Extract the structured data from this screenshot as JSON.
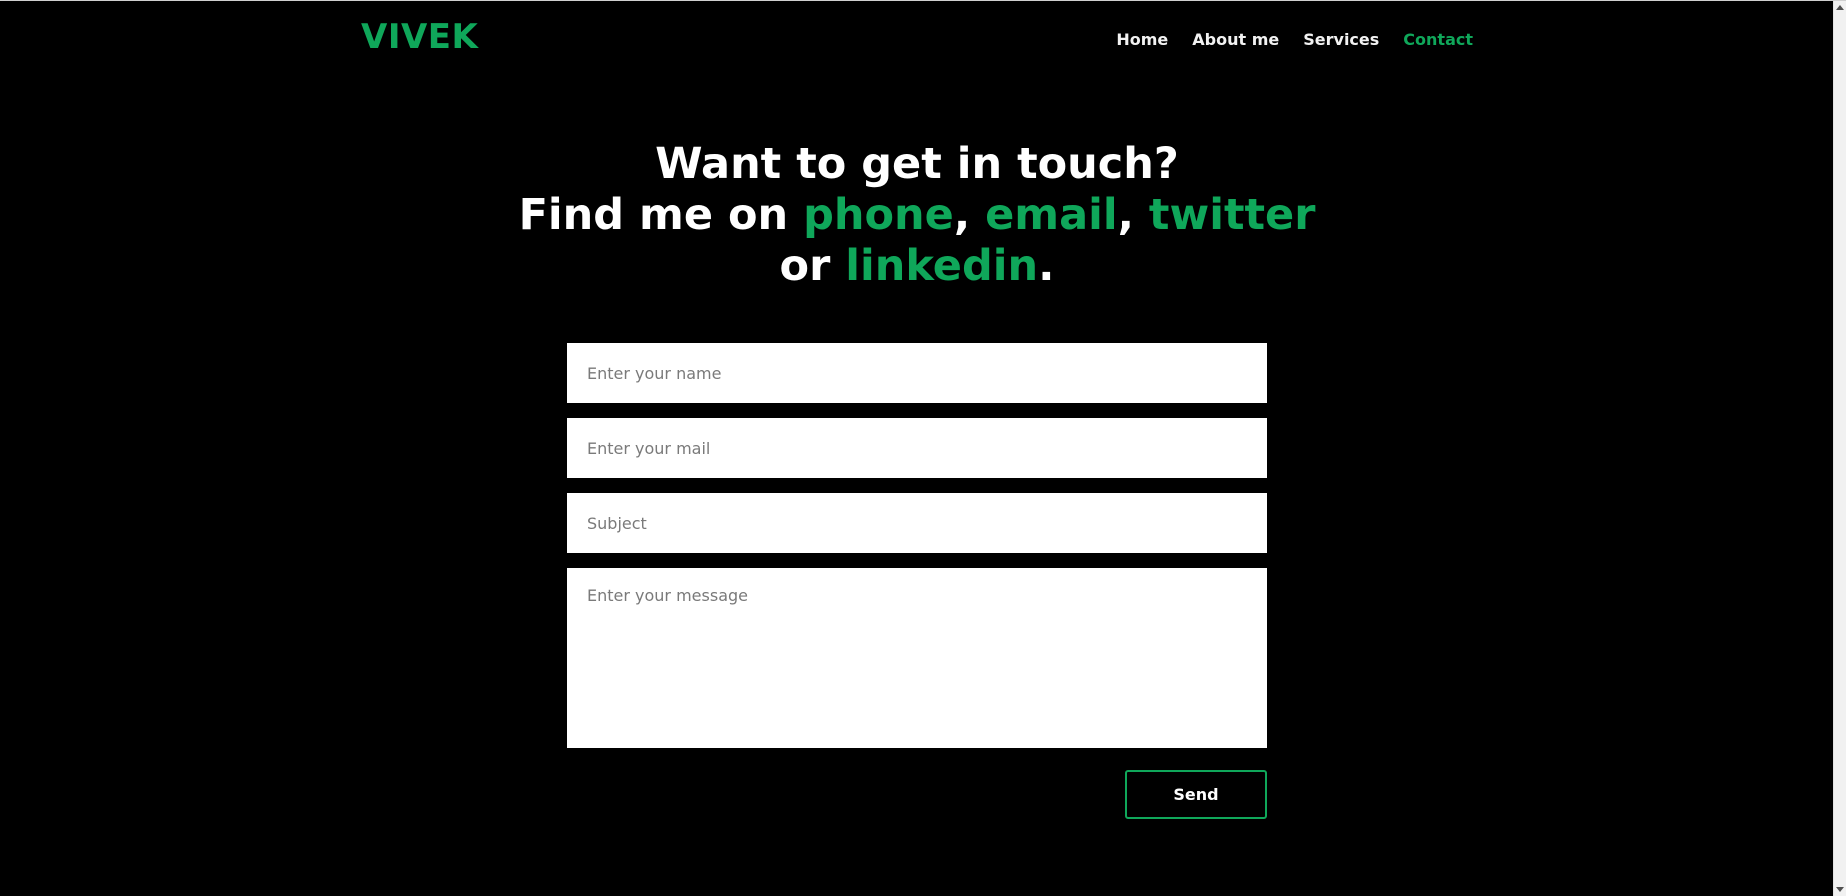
{
  "header": {
    "logo": "VIVEK",
    "nav": [
      {
        "label": "Home"
      },
      {
        "label": "About me"
      },
      {
        "label": "Services"
      },
      {
        "label": "Contact"
      }
    ]
  },
  "hero": {
    "line1": "Want to get in touch?",
    "find_prefix": "Find me on ",
    "phone": "phone",
    "comma1": ", ",
    "email": "email",
    "comma2": ", ",
    "twitter": "twitter",
    "or_text": "or ",
    "linkedin": "linkedin",
    "period": "."
  },
  "form": {
    "name_placeholder": "Enter your name",
    "mail_placeholder": "Enter your mail",
    "subject_placeholder": "Subject",
    "message_placeholder": "Enter your message",
    "send_label": "Send"
  },
  "colors": {
    "accent": "#0fa75a",
    "background": "#000000",
    "text": "#ffffff"
  }
}
